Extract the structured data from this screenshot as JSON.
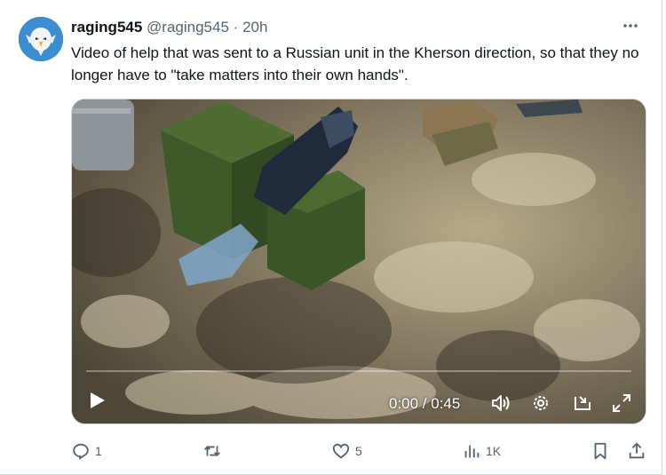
{
  "tweet": {
    "display_name": "raging545",
    "handle": "@raging545",
    "separator": "·",
    "time": "20h",
    "text": "Video of help that was sent to a Russian unit in the Kherson direction, so that they no longer have to \"take matters into their own hands\".",
    "more_icon": "more-horizontal-icon",
    "avatar_icon": "eagle-avatar"
  },
  "video": {
    "time_display": "0:00 / 0:45",
    "progress": 0,
    "play_icon": "play-icon",
    "volume_icon": "volume-icon",
    "settings_icon": "gear-icon",
    "popout_icon": "picture-in-picture-icon",
    "fullscreen_icon": "fullscreen-icon"
  },
  "actions": {
    "reply_count": "1",
    "retweet_count": "",
    "like_count": "5",
    "views_count": "1K"
  },
  "colors": {
    "text_primary": "#0f1419",
    "text_secondary": "#536471",
    "border": "#cfd9de"
  }
}
